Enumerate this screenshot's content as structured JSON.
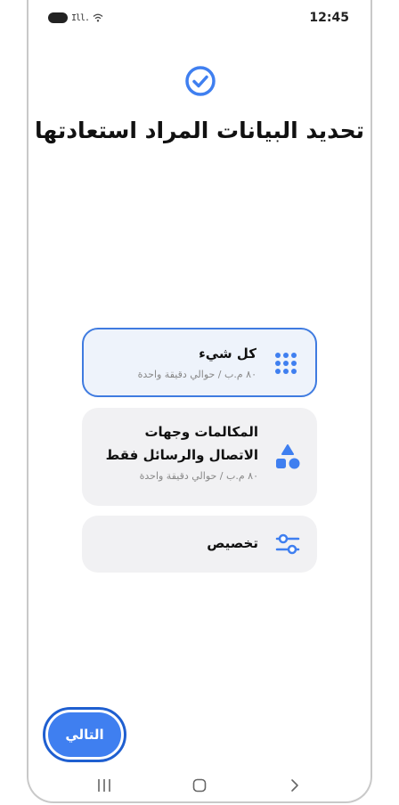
{
  "status": {
    "time": "12:45",
    "signal": "Ill."
  },
  "page": {
    "title": "تحديد البيانات المراد استعادتها"
  },
  "options": [
    {
      "title": "كل شيء",
      "subtitle": "٨٠ م.ب / حوالي دقيقة واحدة",
      "icon": "grid-dots-icon",
      "selected": true
    },
    {
      "title": "المكالمات وجهات الاتصال والرسائل فقط",
      "subtitle": "٨٠ م.ب / حوالي دقيقة واحدة",
      "icon": "shapes-icon",
      "selected": false
    },
    {
      "title": "تخصيص",
      "subtitle": "",
      "icon": "sliders-icon",
      "selected": false
    }
  ],
  "actions": {
    "next_label": "التالي"
  },
  "colors": {
    "accent": "#3f7ff0",
    "accent_dark": "#1f5fd0",
    "card_bg": "#f1f1f3"
  }
}
